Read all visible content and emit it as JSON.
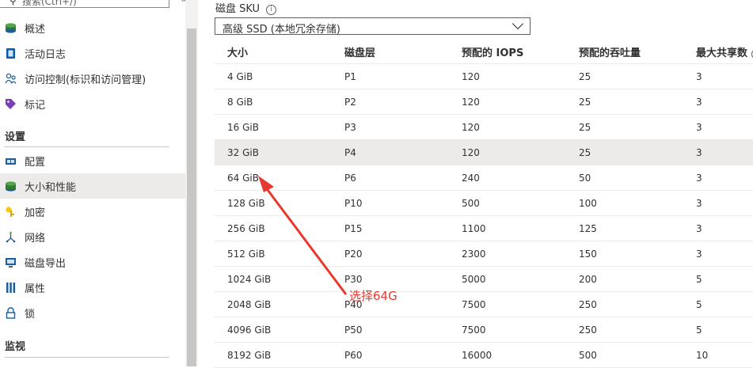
{
  "sidebar": {
    "search_placeholder": "搜索(Ctrl+/)",
    "collapse_icon": "double-chevron-left",
    "top_items": [
      {
        "label": "概述",
        "icon": "disk-icon"
      },
      {
        "label": "活动日志",
        "icon": "log-icon"
      },
      {
        "label": "访问控制(标识和访问管理)",
        "icon": "people-icon"
      },
      {
        "label": "标记",
        "icon": "tag-icon"
      }
    ],
    "settings_header": "设置",
    "settings_items": [
      {
        "label": "配置",
        "icon": "config-icon"
      },
      {
        "label": "大小和性能",
        "icon": "disk-icon",
        "selected": true
      },
      {
        "label": "加密",
        "icon": "key-icon"
      },
      {
        "label": "网络",
        "icon": "network-icon"
      },
      {
        "label": "磁盘导出",
        "icon": "export-icon"
      },
      {
        "label": "属性",
        "icon": "properties-icon"
      },
      {
        "label": "锁",
        "icon": "lock-icon"
      }
    ],
    "monitor_header": "监视"
  },
  "main": {
    "sku_label": "磁盘 SKU",
    "sku_value": "高级 SSD (本地冗余存储)",
    "table": {
      "headers": [
        "大小",
        "磁盘层",
        "预配的 IOPS",
        "预配的吞吐量",
        "最大共享数"
      ],
      "rows": [
        [
          "4 GiB",
          "P1",
          "120",
          "25",
          "3"
        ],
        [
          "8 GiB",
          "P2",
          "120",
          "25",
          "3"
        ],
        [
          "16 GiB",
          "P3",
          "120",
          "25",
          "3"
        ],
        [
          "32 GiB",
          "P4",
          "120",
          "25",
          "3"
        ],
        [
          "64 GiB",
          "P6",
          "240",
          "50",
          "3"
        ],
        [
          "128 GiB",
          "P10",
          "500",
          "100",
          "3"
        ],
        [
          "256 GiB",
          "P15",
          "1100",
          "125",
          "3"
        ],
        [
          "512 GiB",
          "P20",
          "2300",
          "150",
          "3"
        ],
        [
          "1024 GiB",
          "P30",
          "5000",
          "200",
          "5"
        ],
        [
          "2048 GiB",
          "P40",
          "7500",
          "250",
          "5"
        ],
        [
          "4096 GiB",
          "P50",
          "7500",
          "250",
          "5"
        ],
        [
          "8192 GiB",
          "P60",
          "16000",
          "500",
          "10"
        ]
      ],
      "highlighted_row": 3
    }
  },
  "annotation": {
    "text": "选择64G",
    "color": "#e8392f"
  }
}
